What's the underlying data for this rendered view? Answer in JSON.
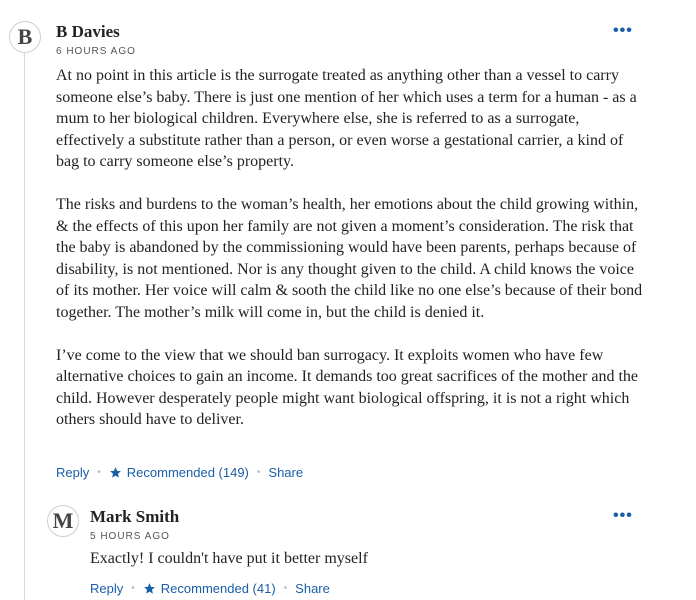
{
  "comments": [
    {
      "avatar_letter": "B",
      "author": "B Davies",
      "time": "6 HOURS AGO",
      "more_label": "•••",
      "paragraphs": [
        "At no point in this article is the surrogate treated as anything other than a vessel to carry someone else’s baby.  There is just one mention of her which uses a term for a human - as a mum to her biological children.  Everywhere else, she is referred to as a surrogate, effectively a substitute rather than a person, or even worse a gestational carrier, a kind of bag to carry someone else’s property.",
        "The risks and burdens to the woman’s health, her emotions about the child growing within,  & the effects of this upon her family are not given a moment’s consideration. The risk that the baby is abandoned by the commissioning would have been parents, perhaps because of disability, is not mentioned.  Nor is any thought given to the child. A child knows the voice of its mother. Her voice will calm & sooth the child like no one else’s because of their bond together.  The mother’s milk will come in, but the child is denied it.",
        "I’ve come to the view that we should ban surrogacy.  It exploits women who have few alternative choices to gain an income. It demands too great sacrifices of the mother and the child.  However desperately people might want biological offspring, it is not a right which others should have to deliver."
      ],
      "reply_label": "Reply",
      "recommended_label": "Recommended (149)",
      "share_label": "Share",
      "separator": "•"
    },
    {
      "avatar_letter": "M",
      "author": "Mark Smith",
      "time": "5 HOURS AGO",
      "more_label": "•••",
      "paragraphs": [
        "Exactly! I couldn't have put it better myself"
      ],
      "reply_label": "Reply",
      "recommended_label": "Recommended (41)",
      "share_label": "Share",
      "separator": "•"
    }
  ],
  "colors": {
    "link": "#1a5ea8",
    "text": "#222222",
    "muted": "#555555",
    "rule": "#d8d8d8"
  }
}
